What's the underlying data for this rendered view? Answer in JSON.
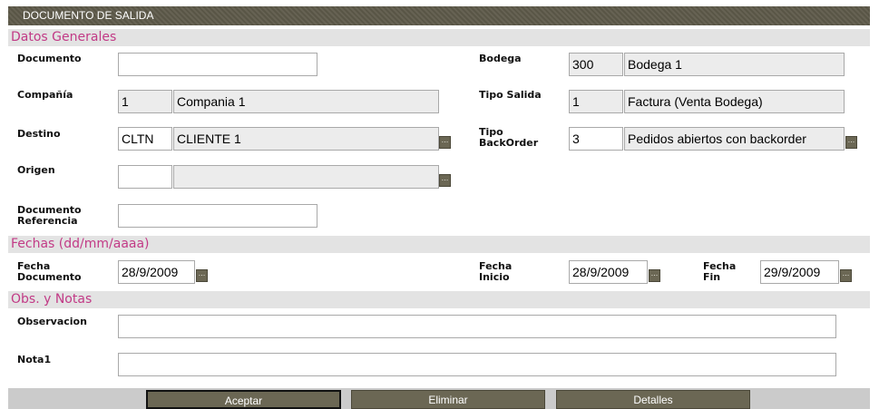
{
  "window": {
    "title": "DOCUMENTO DE SALIDA"
  },
  "sections": {
    "general": "Datos Generales",
    "dates": "Fechas (dd/mm/aaaa)",
    "notes": "Obs. y Notas"
  },
  "general": {
    "documento_label": "Documento",
    "documento_value": "",
    "compania_label": "Compañía",
    "compania_code": "1",
    "compania_name": "Compania 1",
    "destino_label": "Destino",
    "destino_code": "CLTN",
    "destino_name": "CLIENTE 1",
    "origen_label": "Origen",
    "origen_code": "",
    "origen_name": "",
    "doc_ref_label_1": "Documento",
    "doc_ref_label_2": "Referencia",
    "doc_ref_value": "",
    "bodega_label": "Bodega",
    "bodega_code": "300",
    "bodega_name": "Bodega 1",
    "tipo_salida_label": "Tipo Salida",
    "tipo_salida_code": "1",
    "tipo_salida_name": "Factura (Venta Bodega)",
    "tipo_bo_label_1": "Tipo",
    "tipo_bo_label_2": "BackOrder",
    "tipo_bo_code": "3",
    "tipo_bo_name": "Pedidos abiertos con backorder",
    "lookup_glyph": "..."
  },
  "dates": {
    "fecha_doc_label_1": "Fecha",
    "fecha_doc_label_2": "Documento",
    "fecha_doc_value": "28/9/2009",
    "fecha_inicio_label_1": "Fecha",
    "fecha_inicio_label_2": "Inicio",
    "fecha_inicio_value": "28/9/2009",
    "fecha_fin_label_1": "Fecha",
    "fecha_fin_label_2": "Fin",
    "fecha_fin_value": "29/9/2009"
  },
  "notes": {
    "observacion_label": "Observacion",
    "observacion_value": "",
    "nota1_label": "Nota1",
    "nota1_value": ""
  },
  "buttons": {
    "aceptar": "Aceptar",
    "eliminar": "Eliminar",
    "detalles": "Detalles"
  },
  "colors": {
    "titlebar": "#5e5a4a",
    "section_text": "#c23a86",
    "section_bg": "#e3e3e3",
    "button_bg": "#6b6754"
  }
}
